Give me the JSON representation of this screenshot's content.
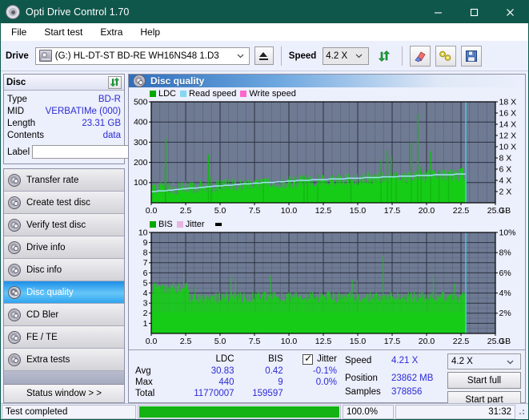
{
  "window": {
    "title": "Opti Drive Control 1.70",
    "icon": "disc-icon",
    "minimize": "–",
    "maximize": "□",
    "close": "✕"
  },
  "menu": {
    "items": [
      "File",
      "Start test",
      "Extra",
      "Help"
    ]
  },
  "toolbar": {
    "drive_label": "Drive",
    "drive_value": "(G:)  HL-DT-ST BD-RE  WH16NS48 1.D3",
    "eject_title": "eject",
    "speed_label": "Speed",
    "speed_value": "4.2 X",
    "icons": [
      "refresh-icon",
      "eraser-icon",
      "tools-icon",
      "save-icon"
    ]
  },
  "disc_panel": {
    "title": "Disc",
    "refresh_icon": "refresh-icon",
    "rows": [
      {
        "key": "Type",
        "value": "BD-R"
      },
      {
        "key": "MID",
        "value": "VERBATIMe (000)"
      },
      {
        "key": "Length",
        "value": "23.31 GB"
      },
      {
        "key": "Contents",
        "value": "data"
      }
    ],
    "label_key": "Label",
    "label_value": "",
    "label_placeholder": ""
  },
  "sidebar": {
    "items": [
      {
        "label": "Transfer rate",
        "icon": "disc-icon",
        "active": false
      },
      {
        "label": "Create test disc",
        "icon": "disc-icon",
        "active": false
      },
      {
        "label": "Verify test disc",
        "icon": "disc-icon",
        "active": false
      },
      {
        "label": "Drive info",
        "icon": "disc-icon",
        "active": false
      },
      {
        "label": "Disc info",
        "icon": "disc-icon",
        "active": false
      },
      {
        "label": "Disc quality",
        "icon": "disc-icon",
        "active": true
      },
      {
        "label": "CD Bler",
        "icon": "disc-icon",
        "active": false
      },
      {
        "label": "FE / TE",
        "icon": "disc-icon",
        "active": false
      },
      {
        "label": "Extra tests",
        "icon": "disc-icon",
        "active": false
      }
    ],
    "status_button": "Status window > >"
  },
  "main": {
    "header_title": "Disc quality",
    "header_icon": "disc-icon"
  },
  "chart_data": [
    {
      "type": "bar",
      "name": "ldc-chart",
      "title": "",
      "xlabel": "GB",
      "ylabel": "LDC",
      "xlim": [
        0,
        25.0
      ],
      "ylim": [
        0,
        500
      ],
      "y2lim": [
        0,
        18
      ],
      "y2label": "X",
      "xticks": [
        "0.0",
        "2.5",
        "5.0",
        "7.5",
        "10.0",
        "12.5",
        "15.0",
        "17.5",
        "20.0",
        "22.5",
        "25.0"
      ],
      "xunit": "GB",
      "yticks": [
        100,
        200,
        300,
        400,
        500
      ],
      "y2ticks": [
        "2 X",
        "4 X",
        "6 X",
        "8 X",
        "10 X",
        "12 X",
        "14 X",
        "16 X",
        "18 X"
      ],
      "grid": true,
      "legend": [
        {
          "label": "LDC",
          "color": "#00a800"
        },
        {
          "label": "Read speed",
          "color": "#86d8f2"
        },
        {
          "label": "Write speed",
          "color": "#ff66cc"
        }
      ],
      "plot_bg": "#6f7a93",
      "data_end_gb": 22.9,
      "ldc_baseline": [
        38,
        42,
        45,
        48,
        46,
        44,
        47,
        50,
        48,
        46,
        49,
        52,
        50,
        48,
        51,
        49,
        47,
        50,
        53,
        51,
        49,
        52,
        50,
        48,
        51,
        54,
        52,
        50,
        53,
        55,
        52,
        50,
        53,
        56,
        54,
        52,
        55,
        57,
        55,
        53,
        56,
        58,
        56,
        54,
        57,
        59,
        57,
        55,
        58,
        60,
        58,
        56,
        59,
        62,
        60,
        58,
        61,
        63,
        61,
        59,
        62,
        64,
        62,
        60,
        63,
        65,
        63,
        61,
        64,
        66,
        64,
        62,
        65,
        67,
        65,
        63,
        66,
        68,
        66,
        64,
        67,
        70,
        68,
        66,
        69,
        71,
        69,
        67,
        70,
        72,
        70,
        68,
        71,
        74,
        72,
        70,
        73,
        75,
        73,
        71,
        74,
        76,
        74,
        72,
        75,
        78,
        76,
        74,
        77,
        79,
        77,
        75,
        78,
        80,
        78,
        76,
        79,
        82,
        80,
        78,
        81,
        83,
        81,
        79,
        82,
        84,
        82,
        80,
        83,
        86,
        84,
        82,
        85,
        87,
        85,
        83,
        86,
        88,
        86,
        84,
        87,
        90,
        88,
        86,
        89,
        91,
        89,
        87,
        90,
        92,
        90,
        88,
        91,
        94,
        92,
        90,
        93,
        95,
        93,
        91,
        94,
        96,
        94,
        92,
        95,
        97,
        95,
        93,
        96,
        98,
        96,
        94,
        97,
        99,
        97,
        95,
        98,
        100,
        98,
        96,
        99,
        101,
        99,
        97,
        100,
        102,
        100,
        98,
        101,
        103,
        101,
        99,
        102,
        104,
        102,
        100,
        103,
        105,
        103,
        101,
        104,
        106,
        104,
        102,
        105,
        107,
        105,
        103,
        106,
        108,
        106,
        104,
        107,
        109,
        107,
        105,
        108,
        110,
        108,
        106,
        109,
        111,
        109,
        107,
        110,
        112,
        110,
        108,
        111,
        113,
        111,
        109,
        112,
        114,
        112,
        110,
        113,
        115,
        113,
        111,
        114,
        116,
        114,
        112,
        115,
        117,
        115,
        113,
        116,
        118,
        116,
        114,
        117,
        119,
        117,
        115,
        118,
        120,
        118,
        116,
        119,
        121,
        119,
        117,
        120,
        122
      ],
      "ldc_spikes": [
        {
          "gb": 1.05,
          "value": 320
        },
        {
          "gb": 1.02,
          "value": 175
        },
        {
          "gb": 4.15,
          "value": 240
        },
        {
          "gb": 4.35,
          "value": 130
        },
        {
          "gb": 8.15,
          "value": 120
        },
        {
          "gb": 11.1,
          "value": 130
        },
        {
          "gb": 11.35,
          "value": 120
        },
        {
          "gb": 12.1,
          "value": 140
        },
        {
          "gb": 14.5,
          "value": 120
        },
        {
          "gb": 16.7,
          "value": 215
        },
        {
          "gb": 17.15,
          "value": 260
        },
        {
          "gb": 17.45,
          "value": 230
        },
        {
          "gb": 17.8,
          "value": 150
        },
        {
          "gb": 18.9,
          "value": 300
        },
        {
          "gb": 19.35,
          "value": 440
        },
        {
          "gb": 19.6,
          "value": 180
        },
        {
          "gb": 20.3,
          "value": 255
        },
        {
          "gb": 20.9,
          "value": 160
        },
        {
          "gb": 21.6,
          "value": 150
        }
      ],
      "read_speed": [
        {
          "gb": 0.0,
          "x": 2.0
        },
        {
          "gb": 1.2,
          "x": 2.2
        },
        {
          "gb": 2.4,
          "x": 2.5
        },
        {
          "gb": 3.6,
          "x": 2.7
        },
        {
          "gb": 4.8,
          "x": 3.0
        },
        {
          "gb": 6.0,
          "x": 3.2
        },
        {
          "gb": 7.6,
          "x": 3.5
        },
        {
          "gb": 9.2,
          "x": 3.7
        },
        {
          "gb": 11.0,
          "x": 4.0
        },
        {
          "gb": 13.0,
          "x": 4.2
        },
        {
          "gb": 15.0,
          "x": 4.4
        },
        {
          "gb": 17.0,
          "x": 4.6
        },
        {
          "gb": 19.0,
          "x": 4.8
        },
        {
          "gb": 21.0,
          "x": 5.0
        },
        {
          "gb": 22.6,
          "x": 5.1
        }
      ],
      "cursor_gb": 22.85
    },
    {
      "type": "bar",
      "name": "bis-chart",
      "title": "",
      "xlabel": "GB",
      "ylabel": "BIS",
      "xlim": [
        0,
        25.0
      ],
      "ylim": [
        0,
        10
      ],
      "y2lim": [
        0,
        10
      ],
      "y2label": "%",
      "xticks": [
        "0.0",
        "2.5",
        "5.0",
        "7.5",
        "10.0",
        "12.5",
        "15.0",
        "17.5",
        "20.0",
        "22.5",
        "25.0"
      ],
      "xunit": "GB",
      "yticks": [
        1,
        2,
        3,
        4,
        5,
        6,
        7,
        8,
        9,
        10
      ],
      "y2ticks": [
        "2%",
        "4%",
        "6%",
        "8%",
        "10%"
      ],
      "grid": true,
      "legend": [
        {
          "label": "BIS",
          "color": "#00a800"
        },
        {
          "label": "Jitter",
          "color": "#e8b4e0"
        }
      ],
      "plot_bg": "#6f7a93",
      "data_end_gb": 22.9,
      "bis_base": 3.6,
      "cursor_gb": 22.85
    }
  ],
  "stats": {
    "columns": [
      "",
      "LDC",
      "BIS",
      "Jitter"
    ],
    "jitter_checked": true,
    "rows": [
      {
        "label": "Avg",
        "ldc": "30.83",
        "bis": "0.42",
        "jitter": "-0.1%"
      },
      {
        "label": "Max",
        "ldc": "440",
        "bis": "9",
        "jitter": "0.0%"
      },
      {
        "label": "Total",
        "ldc": "11770007",
        "bis": "159597",
        "jitter": ""
      }
    ]
  },
  "run_info": {
    "speed_label": "Speed",
    "speed_value": "4.21 X",
    "position_label": "Position",
    "position_value": "23862 MB",
    "samples_label": "Samples",
    "samples_value": "378856",
    "speed_select": "4.2 X",
    "start_full": "Start full",
    "start_part": "Start part"
  },
  "statusbar": {
    "message": "Test completed",
    "progress_pct": 100.0,
    "progress_text": "100.0%",
    "elapsed": "31:32"
  }
}
